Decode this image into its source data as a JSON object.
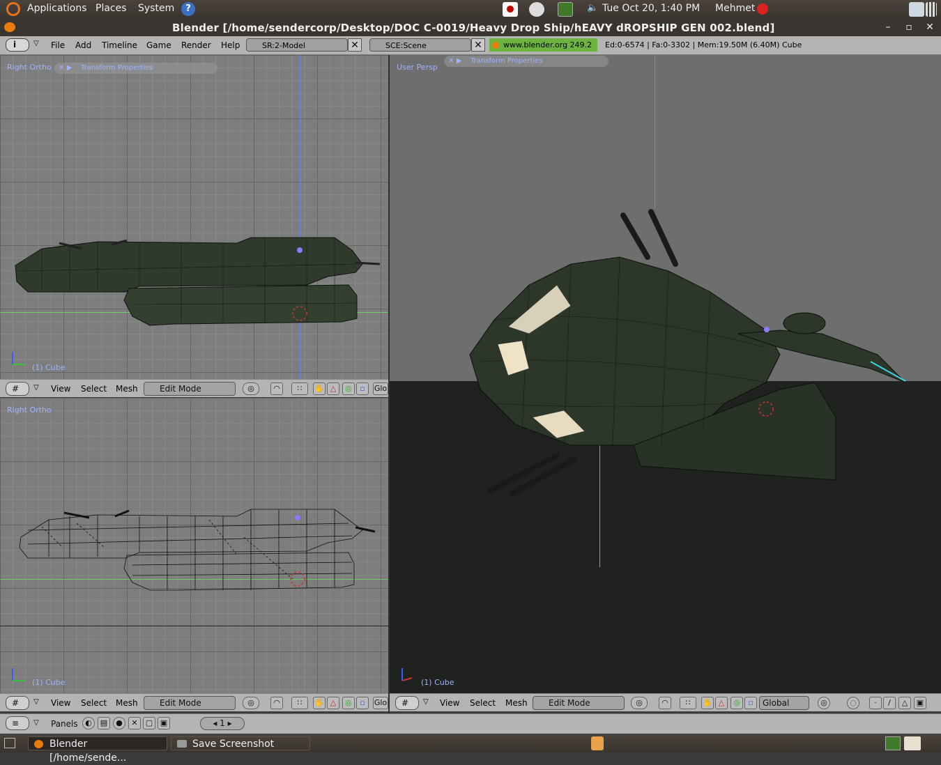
{
  "top_panel": {
    "menus": [
      "Applications",
      "Places",
      "System"
    ],
    "clock": "Tue Oct 20,  1:40 PM",
    "user": "Mehmet"
  },
  "window": {
    "title": "Blender [/home/sendercorp/Desktop/DOC    C-0019/Heavy Drop Ship/hEAVY dROPSHIP GEN 002.blend]",
    "buttons": [
      "–",
      "▫",
      "✕"
    ]
  },
  "info_header": {
    "menus": [
      "File",
      "Add",
      "Timeline",
      "Game",
      "Render",
      "Help"
    ],
    "screen": "SR:2-Model",
    "scene": "SCE:Scene",
    "url": "www.blender.org 249.2",
    "stats": "Ed:0-6574 | Fa:0-3302 | Mem:19.50M (6.40M) Cube"
  },
  "viewport_top_left": {
    "view_label": "Right Ortho",
    "panel_tab": "Transform Properties",
    "object_label": "(1) Cube"
  },
  "viewport_bottom_left": {
    "view_label": "Right Ortho",
    "object_label": "(1) Cube"
  },
  "viewport_right": {
    "view_label": "User Persp",
    "panel_tab": "Transform Properties",
    "object_label": "(1) Cube"
  },
  "header3d": {
    "menus": [
      "View",
      "Select",
      "Mesh"
    ],
    "mode": "Edit Mode",
    "orientation_left": "Glo",
    "orientation": "Global"
  },
  "buttons_window": {
    "label": "Panels",
    "frame": "1"
  },
  "taskbar": {
    "tasks": [
      "Blender [/home/sende...",
      "Save Screenshot"
    ]
  },
  "colors": {
    "panel_bg": "#3c3530",
    "blender_header": "#b4b4b4",
    "viewport_grid": "#7d7d7d",
    "ship_green": "#2f3a2c",
    "url_green": "#6db33f",
    "label_blue": "#9fb4ff"
  }
}
